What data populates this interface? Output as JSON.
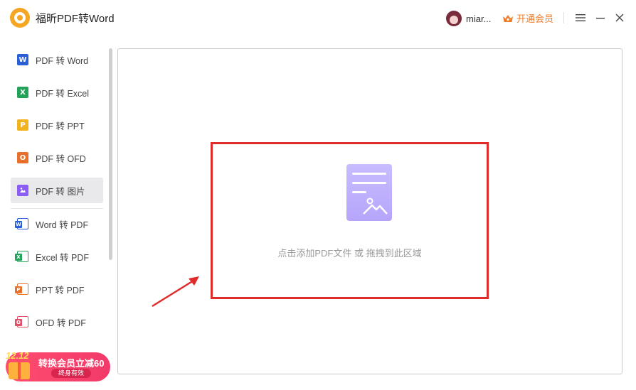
{
  "app": {
    "title": "福昕PDF转Word"
  },
  "header": {
    "username": "miar...",
    "vip_label": "开通会员"
  },
  "sidebar": {
    "items": [
      {
        "label": "PDF 转 Word",
        "icon": "word-icon",
        "icon_letter": "W",
        "color": "#2b5fd9",
        "active": false
      },
      {
        "label": "PDF 转 Excel",
        "icon": "excel-icon",
        "icon_letter": "X",
        "color": "#21a35a",
        "active": false
      },
      {
        "label": "PDF 转 PPT",
        "icon": "ppt-icon",
        "icon_letter": "P",
        "color": "#f2b320",
        "active": false
      },
      {
        "label": "PDF 转 OFD",
        "icon": "ofd-icon",
        "icon_letter": "O",
        "color": "#e8702a",
        "active": false
      },
      {
        "label": "PDF 转 图片",
        "icon": "image-icon",
        "icon_letter": "",
        "color": "#8b5cf6",
        "active": true
      },
      {
        "label": "Word 转 PDF",
        "icon": "word-to-pdf-icon",
        "icon_letter": "W",
        "color": "#2b5fd9",
        "active": false
      },
      {
        "label": "Excel 转 PDF",
        "icon": "excel-to-pdf-icon",
        "icon_letter": "X",
        "color": "#21a35a",
        "active": false
      },
      {
        "label": "PPT 转 PDF",
        "icon": "ppt-to-pdf-icon",
        "icon_letter": "P",
        "color": "#e8702a",
        "active": false
      },
      {
        "label": "OFD 转 PDF",
        "icon": "ofd-to-pdf-icon",
        "icon_letter": "O",
        "color": "#e0506a",
        "active": false
      }
    ]
  },
  "promo": {
    "date": "12.12",
    "title": "转换会员立减60",
    "subtitle": "终身有效"
  },
  "main": {
    "drop_hint": "点击添加PDF文件 或 拖拽到此区域"
  },
  "colors": {
    "accent_orange": "#ee7d2c",
    "highlight_red": "#e02b2b",
    "doc_purple": "#c4b5fd"
  }
}
